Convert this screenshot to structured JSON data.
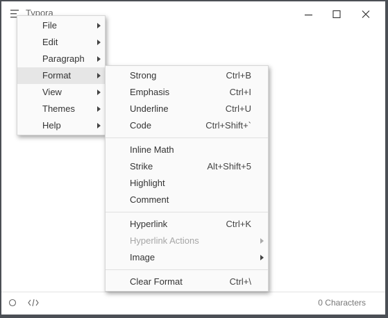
{
  "window": {
    "title": "Typora"
  },
  "main_menu": {
    "items": [
      {
        "label": "File"
      },
      {
        "label": "Edit"
      },
      {
        "label": "Paragraph"
      },
      {
        "label": "Format"
      },
      {
        "label": "View"
      },
      {
        "label": "Themes"
      },
      {
        "label": "Help"
      }
    ]
  },
  "format_menu": {
    "groups": [
      [
        {
          "label": "Strong",
          "shortcut": "Ctrl+B"
        },
        {
          "label": "Emphasis",
          "shortcut": "Ctrl+I"
        },
        {
          "label": "Underline",
          "shortcut": "Ctrl+U"
        },
        {
          "label": "Code",
          "shortcut": "Ctrl+Shift+`"
        }
      ],
      [
        {
          "label": "Inline Math",
          "shortcut": ""
        },
        {
          "label": "Strike",
          "shortcut": "Alt+Shift+5"
        },
        {
          "label": "Highlight",
          "shortcut": ""
        },
        {
          "label": "Comment",
          "shortcut": ""
        }
      ],
      [
        {
          "label": "Hyperlink",
          "shortcut": "Ctrl+K"
        },
        {
          "label": "Hyperlink Actions",
          "shortcut": ""
        },
        {
          "label": "Image",
          "shortcut": ""
        }
      ],
      [
        {
          "label": "Clear Format",
          "shortcut": "Ctrl+\\"
        }
      ]
    ]
  },
  "statusbar": {
    "char_count": "0 Characters"
  }
}
